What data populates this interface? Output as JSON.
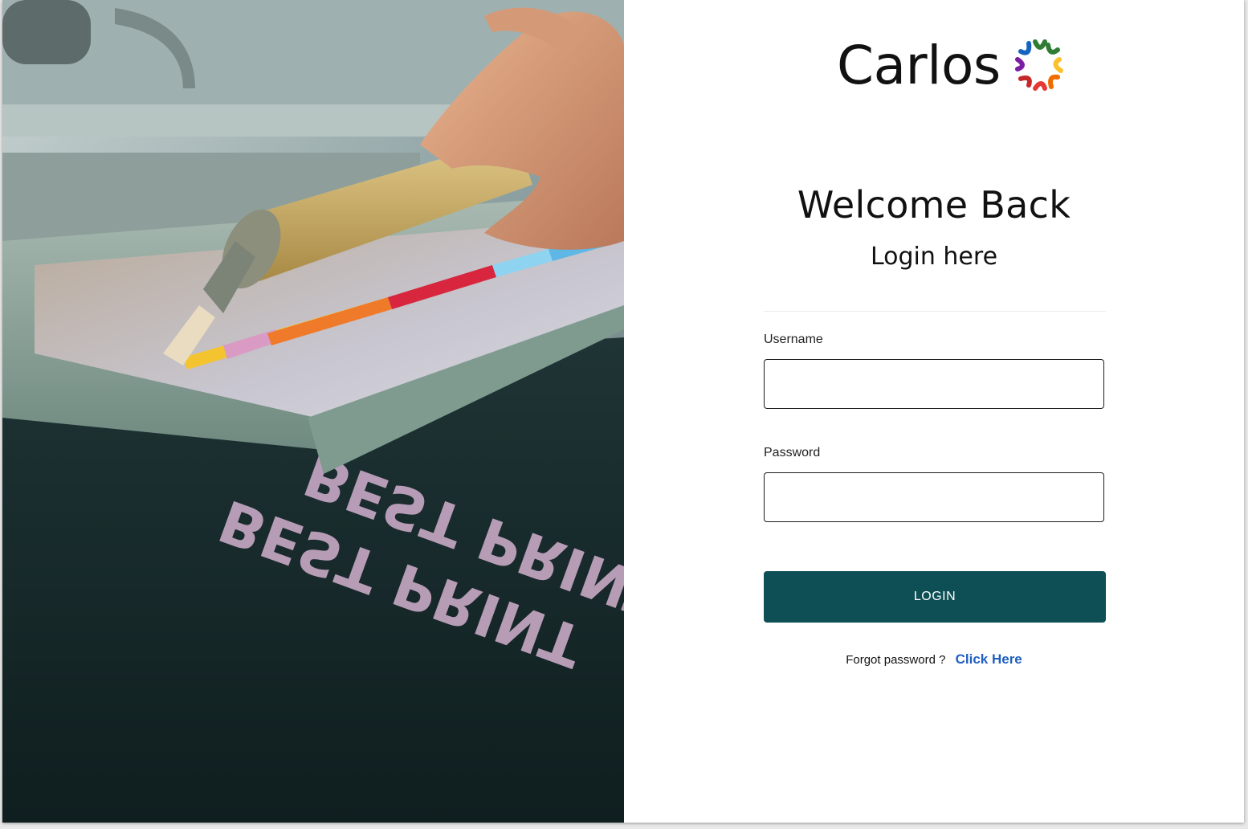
{
  "brand": {
    "name": "Carlos"
  },
  "photo": {
    "print_text": "BEST PRINT"
  },
  "login": {
    "title": "Welcome Back",
    "subtitle": "Login here",
    "username_label": "Username",
    "username_value": "",
    "password_label": "Password",
    "password_value": "",
    "button_label": "LOGIN",
    "forgot_text": "Forgot password ?",
    "forgot_link": "Click Here"
  },
  "colors": {
    "accent": "#0d4f55",
    "link": "#1f5fbf",
    "logo_petals": [
      "#2e7d32",
      "#f9a825",
      "#fbc02d",
      "#ef6c00",
      "#e53935",
      "#c62828",
      "#7b1fa2",
      "#5e35b1",
      "#1565c0"
    ]
  }
}
